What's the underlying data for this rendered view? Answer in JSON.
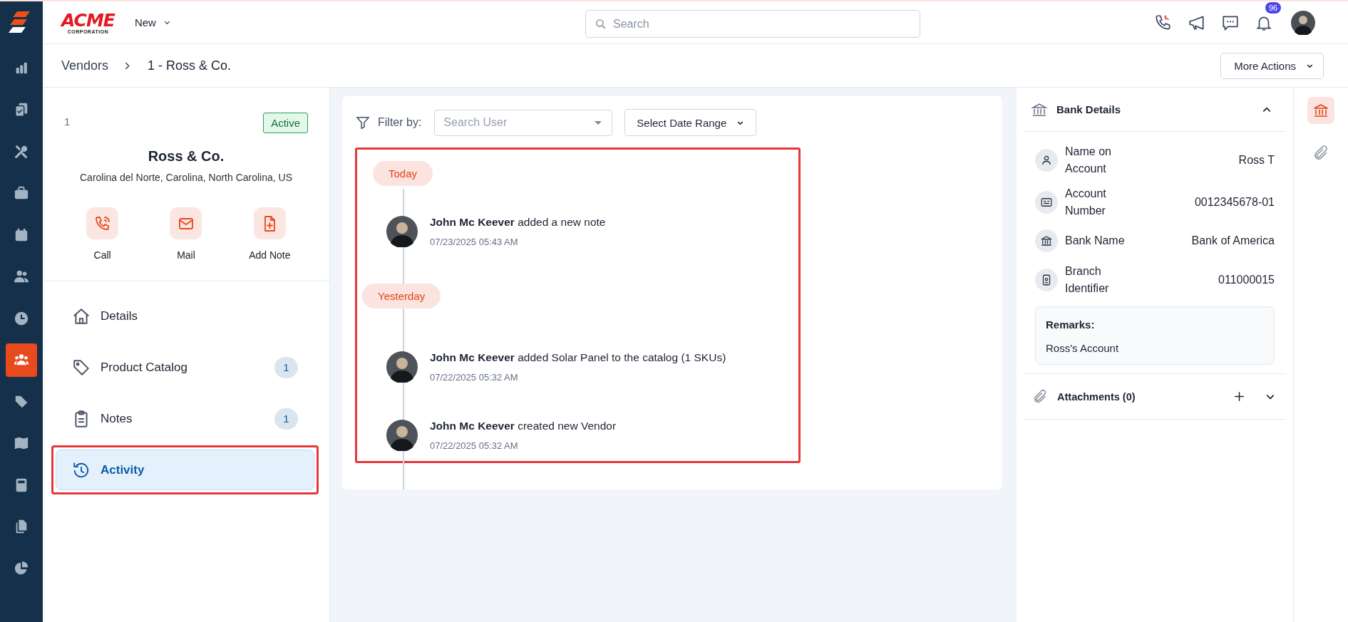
{
  "sidebar": {
    "items": [
      {
        "kind": "chart",
        "selected": false
      },
      {
        "kind": "clipboard",
        "selected": false
      },
      {
        "kind": "tools",
        "selected": false
      },
      {
        "kind": "briefcase",
        "selected": false
      },
      {
        "kind": "calendar",
        "selected": false
      },
      {
        "kind": "people",
        "selected": false
      },
      {
        "kind": "clock",
        "selected": false
      },
      {
        "kind": "team",
        "selected": true
      },
      {
        "kind": "tag",
        "selected": false
      },
      {
        "kind": "map",
        "selected": false
      },
      {
        "kind": "calculator",
        "selected": false
      },
      {
        "kind": "files",
        "selected": false
      },
      {
        "kind": "pie",
        "selected": false
      }
    ]
  },
  "header": {
    "logo": {
      "name": "ACME",
      "subtitle": "CORPORATION"
    },
    "new_menu": "New",
    "search": {
      "placeholder": "Search"
    },
    "notifications": "96"
  },
  "breadcrumb": [
    "Vendors",
    "1 - Ross & Co."
  ],
  "more_actions": "More Actions",
  "vendor": {
    "id": "1",
    "status": "Active",
    "name": "Ross & Co.",
    "address": "Carolina del Norte, Carolina, North Carolina, US",
    "actions": [
      {
        "kind": "call",
        "label": "Call"
      },
      {
        "kind": "mail",
        "label": "Mail"
      },
      {
        "kind": "note",
        "label": "Add Note"
      }
    ]
  },
  "nav": {
    "items": [
      {
        "kind": "home",
        "label": "Details",
        "selected": false,
        "highlighted": false
      },
      {
        "kind": "tag",
        "label": "Product Catalog",
        "count": "1",
        "selected": false,
        "highlighted": false
      },
      {
        "kind": "clipboard",
        "label": "Notes",
        "count": "1",
        "selected": false,
        "highlighted": false
      },
      {
        "kind": "history",
        "label": "Activity",
        "selected": true,
        "highlighted": true
      }
    ]
  },
  "filter": {
    "label": "Filter by:",
    "user": {
      "placeholder": "Search User"
    },
    "date_range": "Select Date Range"
  },
  "activity": {
    "highlighted": true,
    "groups": [
      {
        "label": "Today",
        "entries": [
          {
            "text": "**John Mc Keever** added a new note",
            "time": "07/23/2025 05:43 AM"
          }
        ]
      },
      {
        "label": "Yesterday",
        "entries": [
          {
            "text": "**John Mc Keever** added Solar Panel to the catalog (1 SKUs)",
            "time": "07/22/2025 05:32 AM"
          },
          {
            "text": "**John Mc Keever** created new Vendor",
            "time": "07/22/2025 05:32 AM"
          }
        ]
      }
    ]
  },
  "bank_details": {
    "title": "Bank Details",
    "expanded": true,
    "fields": [
      {
        "kind": "person",
        "label": "Name on Account",
        "value": "Ross T"
      },
      {
        "kind": "card",
        "label": "Account Number",
        "value": "0012345678-01"
      },
      {
        "kind": "bank",
        "label": "Bank Name",
        "value": "Bank of America"
      },
      {
        "kind": "badge",
        "label": "Branch Identifier",
        "value": "011000015"
      }
    ],
    "remarks": {
      "label": "Remarks:",
      "text": "Ross's Account"
    }
  },
  "attachments": {
    "title": "Attachments (0)",
    "expanded": false
  },
  "rail": {
    "items": [
      {
        "kind": "bank",
        "selected": true
      },
      {
        "kind": "paperclip",
        "selected": false
      }
    ]
  }
}
